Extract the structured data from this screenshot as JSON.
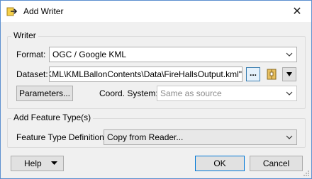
{
  "window": {
    "title": "Add Writer"
  },
  "writer_group": {
    "label": "Writer",
    "format": {
      "label": "Format:",
      "value": "OGC / Google KML"
    },
    "dataset": {
      "label": "Dataset:",
      "value": "ects\\KML\\KMLBallonContents\\Data\\FireHallsOutput.kml\"",
      "browse_label": "..."
    },
    "parameters_label": "Parameters...",
    "coord_system": {
      "label": "Coord. System:",
      "value": "Same as source"
    }
  },
  "feature_group": {
    "label": "Add Feature Type(s)",
    "definition": {
      "label": "Feature Type Definition:",
      "value": "Copy from Reader..."
    }
  },
  "footer": {
    "help_label": "Help",
    "ok_label": "OK",
    "cancel_label": "Cancel"
  }
}
